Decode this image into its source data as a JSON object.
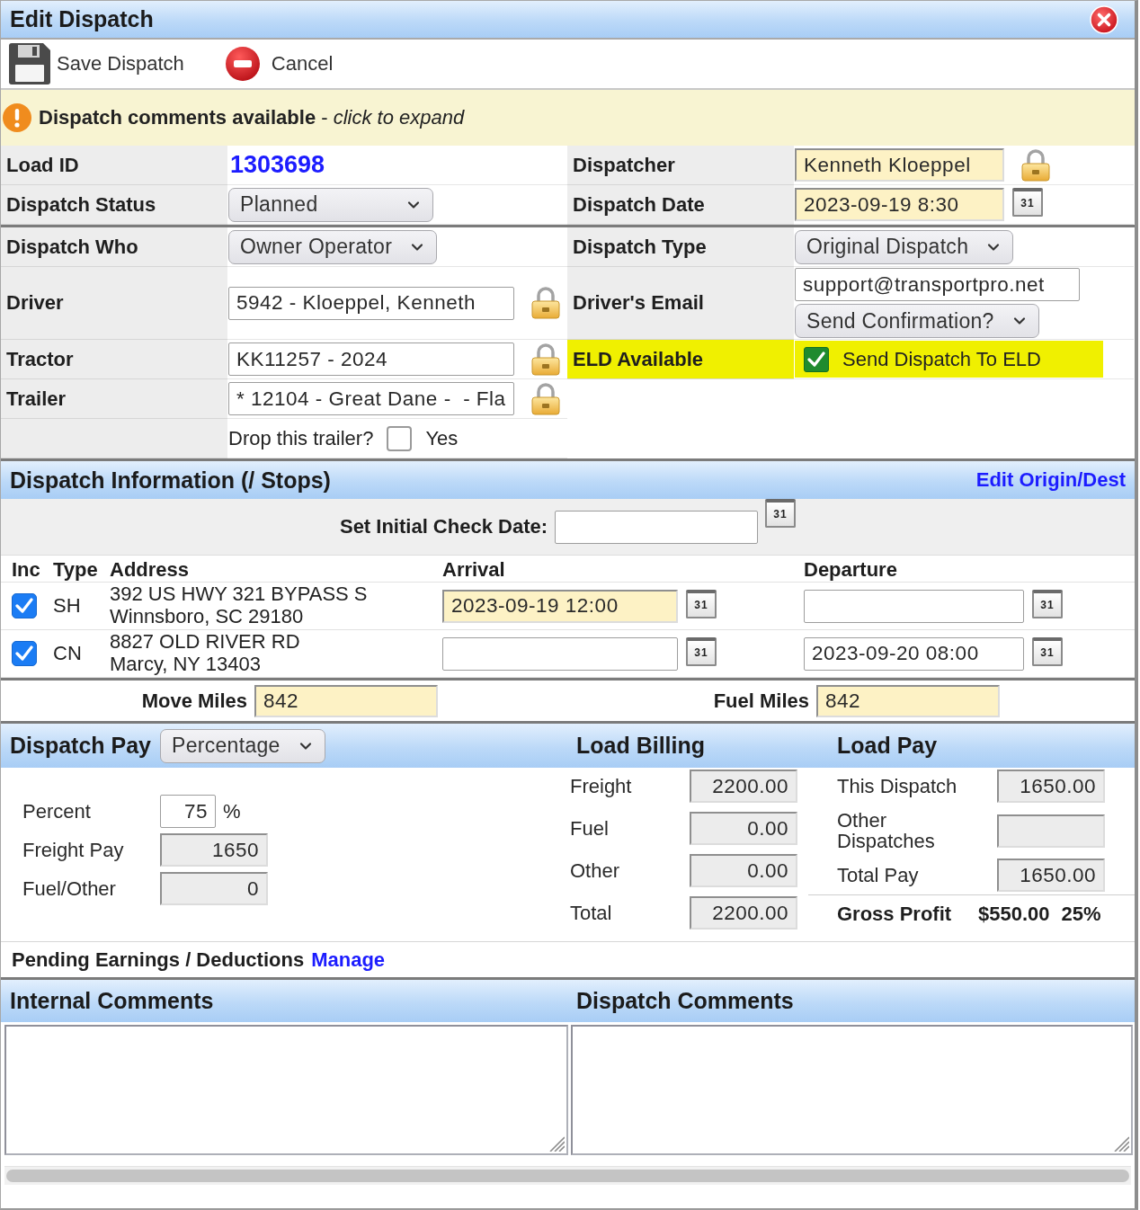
{
  "window": {
    "title": "Edit Dispatch"
  },
  "toolbar": [
    {
      "kind": "save",
      "label": "Save Dispatch"
    },
    {
      "kind": "cancel",
      "label": "Cancel"
    }
  ],
  "notice": {
    "text": "**Dispatch comments available** - *click to expand*"
  },
  "form": {
    "sections": [
      {
        "rows": [
          {
            "left": {
              "label": "Load ID",
              "controls": [
                {
                  "kind": "link",
                  "value": "1303698"
                }
              ]
            },
            "right": {
              "label": "Dispatcher",
              "controls": [
                {
                  "kind": "input",
                  "value": "Kenneth Kloeppel",
                  "highlighted": true,
                  "locked": true
                }
              ]
            }
          },
          {
            "left": {
              "label": "Dispatch Status",
              "controls": [
                {
                  "kind": "select",
                  "value": "Planned"
                }
              ]
            },
            "right": {
              "label": "Dispatch Date",
              "controls": [
                {
                  "kind": "input",
                  "value": "2023-09-19 8:30",
                  "highlighted": true,
                  "calendar": "31"
                }
              ]
            }
          }
        ]
      },
      {
        "rows": [
          {
            "left": {
              "label": "Dispatch Who",
              "controls": [
                {
                  "kind": "select",
                  "value": "Owner Operator"
                }
              ]
            },
            "right": {
              "label": "Dispatch Type",
              "controls": [
                {
                  "kind": "select",
                  "value": "Original Dispatch"
                }
              ]
            }
          },
          {
            "left": {
              "label": "Driver",
              "controls": [
                {
                  "kind": "input",
                  "value": "5942 - Kloeppel, Kenneth",
                  "locked": true
                }
              ]
            },
            "right": {
              "label": "Driver's Email",
              "controls": [
                {
                  "kind": "input",
                  "value": "support@transportpro.net"
                },
                {
                  "kind": "select",
                  "value": "Send Confirmation?"
                }
              ]
            }
          },
          {
            "left": {
              "label": "Tractor",
              "controls": [
                {
                  "kind": "input",
                  "value": "KK11257 - 2024",
                  "locked": true
                }
              ]
            },
            "right": {
              "label": "ELD Available",
              "marked": true,
              "controls": [
                {
                  "kind": "checkbox",
                  "label": "Send Dispatch To ELD",
                  "checked": true
                }
              ]
            }
          },
          {
            "left": {
              "label": "Trailer",
              "controls": [
                {
                  "kind": "input",
                  "value": "* 12104 - Great Dane -  - Fla",
                  "locked": true
                }
              ]
            }
          },
          {
            "left": {
              "controls": [
                {
                  "kind": "checkbox",
                  "prompt": "Drop this trailer?",
                  "label": "Yes",
                  "checked": false
                }
              ]
            }
          }
        ]
      }
    ]
  },
  "stops": {
    "title": "Dispatch Information (/ Stops)",
    "link": "Edit Origin/Dest",
    "check_date": {
      "label": "Set Initial Check Date:",
      "calendar": "31"
    },
    "columns": [
      "Inc",
      "Type",
      "Address",
      "Arrival",
      "Departure"
    ],
    "rows": [
      {
        "checked": true,
        "type": "SH",
        "address": "392 US HWY 321 BYPASS S\nWinnsboro, SC 29180",
        "arrival": {
          "value": "2023-09-19 12:00",
          "highlighted": true,
          "calendar": "31"
        },
        "departure": {
          "calendar": "31"
        }
      },
      {
        "checked": true,
        "type": "CN",
        "address": "8827 OLD RIVER RD\nMarcy, NY 13403",
        "arrival": {
          "calendar": "31"
        },
        "departure": {
          "value": "2023-09-20 08:00",
          "calendar": "31"
        }
      }
    ]
  },
  "miles": [
    {
      "label": "Move Miles",
      "value": "842",
      "highlighted": true
    },
    {
      "label": "Fuel Miles",
      "value": "842",
      "highlighted": true
    }
  ],
  "pay": {
    "title": "Dispatch Pay",
    "method": "Percentage",
    "rows": [
      {
        "label": "Percent",
        "value": "75",
        "unit": "%"
      },
      {
        "label": "Freight Pay",
        "value": "1650",
        "readonly": true
      },
      {
        "label": "Fuel/Other",
        "value": "0",
        "readonly": true
      }
    ]
  },
  "load_billing": {
    "title": "Load Billing",
    "rows": [
      {
        "label": "Freight",
        "value": "2200.00",
        "readonly": true
      },
      {
        "label": "Fuel",
        "value": "0.00",
        "readonly": true
      },
      {
        "label": "Other",
        "value": "0.00",
        "readonly": true
      },
      {
        "label": "Total",
        "value": "2200.00",
        "readonly": true
      }
    ]
  },
  "load_pay": {
    "title": "Load Pay",
    "rows": [
      {
        "label": "This Dispatch",
        "value": "1650.00",
        "readonly": true
      },
      {
        "label": "Other Dispatches",
        "readonly": true
      },
      {
        "label": "Total Pay",
        "value": "1650.00",
        "readonly": true
      }
    ],
    "gross_profit": {
      "label": "Gross Profit",
      "amount": "$550.00",
      "percent": "25%"
    }
  },
  "pending": {
    "label": "Pending Earnings / Deductions",
    "link": "Manage"
  },
  "comments": [
    {
      "title": "Internal Comments"
    },
    {
      "title": "Dispatch Comments"
    }
  ]
}
